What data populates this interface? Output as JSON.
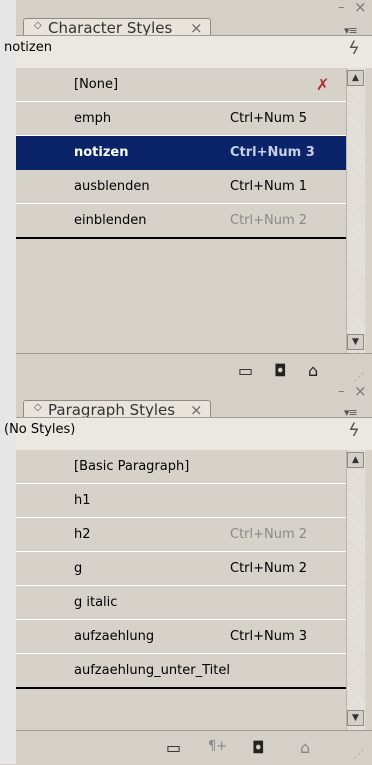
{
  "character_styles": {
    "tab_label": "Character Styles",
    "current": "notizen",
    "items": [
      {
        "name": "[None]",
        "shortcut": ""
      },
      {
        "name": "emph",
        "shortcut": "Ctrl+Num 5"
      },
      {
        "name": "notizen",
        "shortcut": "Ctrl+Num 3"
      },
      {
        "name": "ausblenden",
        "shortcut": "Ctrl+Num 1"
      },
      {
        "name": "einblenden",
        "shortcut": "Ctrl+Num 2"
      }
    ],
    "selected_index": 2
  },
  "paragraph_styles": {
    "tab_label": "Paragraph Styles",
    "current": "(No Styles)",
    "items": [
      {
        "name": "[Basic Paragraph]",
        "shortcut": ""
      },
      {
        "name": "h1",
        "shortcut": ""
      },
      {
        "name": "h2",
        "shortcut": "Ctrl+Num 2"
      },
      {
        "name": "g",
        "shortcut": "Ctrl+Num 2"
      },
      {
        "name": "g italic",
        "shortcut": ""
      },
      {
        "name": "aufzaehlung",
        "shortcut": "Ctrl+Num 3"
      },
      {
        "name": "aufzaehlung_unter_Titel",
        "shortcut": ""
      }
    ]
  },
  "icons": {
    "tab_arrow": "◇",
    "tab_close": "×",
    "window_min": "–",
    "window_close": "×",
    "flyout": "▾≡",
    "lightning": "ϟ",
    "scroll_up": "▲",
    "scroll_down": "▼",
    "folder": "▭",
    "new_style": "◘",
    "trash": "⌂",
    "para_override": "¶+",
    "pencil": "✗"
  },
  "colors": {
    "selection": "#0b2469",
    "panel": "#d6d2ca"
  }
}
